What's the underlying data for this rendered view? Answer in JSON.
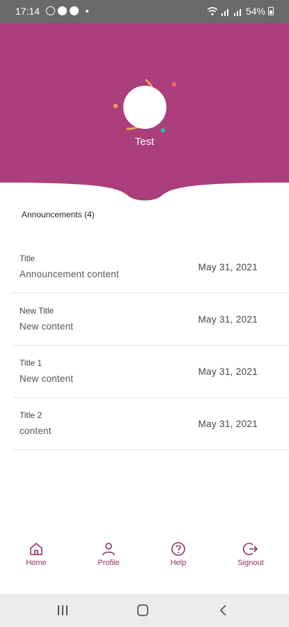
{
  "status_bar": {
    "time": "17:14",
    "battery": "54%",
    "icons": [
      "whatsapp-icon",
      "skype-icon",
      "skype-icon",
      "wifi-icon",
      "signal-icon",
      "signal-icon",
      "battery-icon"
    ]
  },
  "header": {
    "user_name": "Test",
    "background_color": "#ab3e7c",
    "accent_colors": [
      "#f0a05a",
      "#f26c5a",
      "#2bbfa4"
    ]
  },
  "announcements": {
    "heading": "Announcements (4)",
    "items": [
      {
        "title": "Title",
        "content": "Announcement content",
        "date": "May 31, 2021"
      },
      {
        "title": "New Title",
        "content": "New content",
        "date": "May 31, 2021"
      },
      {
        "title": "Title 1",
        "content": "New content",
        "date": "May 31, 2021"
      },
      {
        "title": "Title 2",
        "content": "content",
        "date": "May 31, 2021"
      }
    ]
  },
  "bottom_nav": {
    "items": [
      {
        "label": "Home",
        "icon": "home-icon"
      },
      {
        "label": "Profile",
        "icon": "person-icon"
      },
      {
        "label": "Help",
        "icon": "help-icon"
      },
      {
        "label": "Signout",
        "icon": "signout-icon"
      }
    ],
    "color": "#8e2f63"
  },
  "system_nav": {
    "buttons": [
      "recents-icon",
      "home-circle-icon",
      "back-icon"
    ]
  }
}
